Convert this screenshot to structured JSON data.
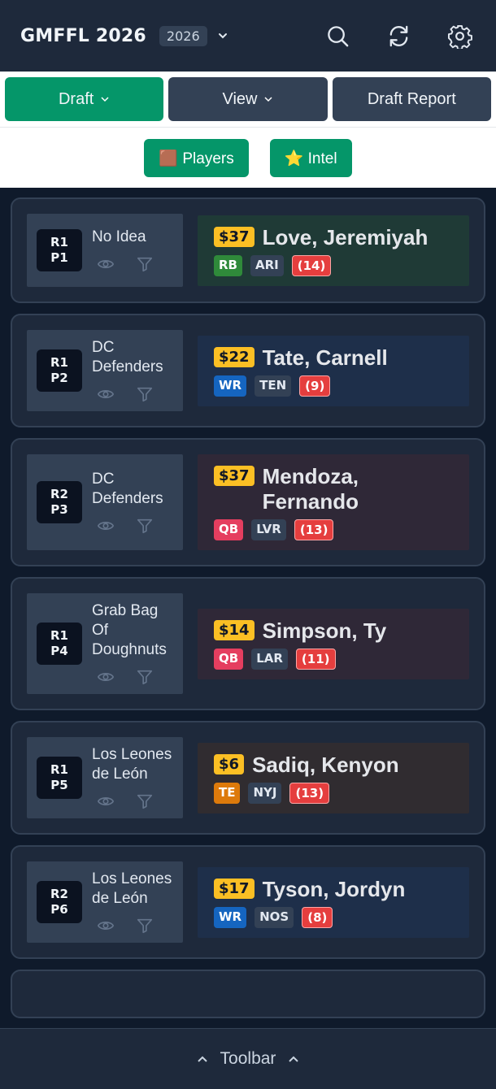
{
  "header": {
    "title": "GMFFL 2026",
    "year_badge": "2026",
    "icons": [
      "search-icon",
      "refresh-icon",
      "gear-icon"
    ]
  },
  "nav": {
    "draft_label": "Draft",
    "view_label": "View",
    "report_label": "Draft Report"
  },
  "subnav": {
    "players_label": "🟫 Players",
    "intel_label": "⭐ Intel"
  },
  "colors": {
    "accent": "#059669",
    "price": "#fbbf24",
    "RB": "#2f8a3a",
    "WR": "#1565c0",
    "QB": "#e53e5f",
    "TE": "#dd7a0b"
  },
  "picks": [
    {
      "round": "R1",
      "pick": "P1",
      "team": "No Idea",
      "price": "$37",
      "player": "Love, Jeremiyah",
      "pos": "RB",
      "nfl": "ARI",
      "bye": "(14)",
      "bg": "#1f3a36"
    },
    {
      "round": "R1",
      "pick": "P2",
      "team": "DC Defenders",
      "price": "$22",
      "player": "Tate, Carnell",
      "pos": "WR",
      "nfl": "TEN",
      "bye": "(9)",
      "bg": "#1e2f4a"
    },
    {
      "round": "R2",
      "pick": "P3",
      "team": "DC Defenders",
      "price": "$37",
      "player": "Mendoza, Fernando",
      "pos": "QB",
      "nfl": "LVR",
      "bye": "(13)",
      "bg": "#2f2837"
    },
    {
      "round": "R1",
      "pick": "P4",
      "team": "Grab Bag Of Doughnuts",
      "price": "$14",
      "player": "Simpson, Ty",
      "pos": "QB",
      "nfl": "LAR",
      "bye": "(11)",
      "bg": "#2f2837"
    },
    {
      "round": "R1",
      "pick": "P5",
      "team": "Los Leones de León",
      "price": "$6",
      "player": "Sadiq, Kenyon",
      "pos": "TE",
      "nfl": "NYJ",
      "bye": "(13)",
      "bg": "#302c30"
    },
    {
      "round": "R2",
      "pick": "P6",
      "team": "Los Leones de León",
      "price": "$17",
      "player": "Tyson, Jordyn",
      "pos": "WR",
      "nfl": "NOS",
      "bye": "(8)",
      "bg": "#1e2f4a"
    }
  ],
  "toolbar": {
    "label": "Toolbar"
  }
}
